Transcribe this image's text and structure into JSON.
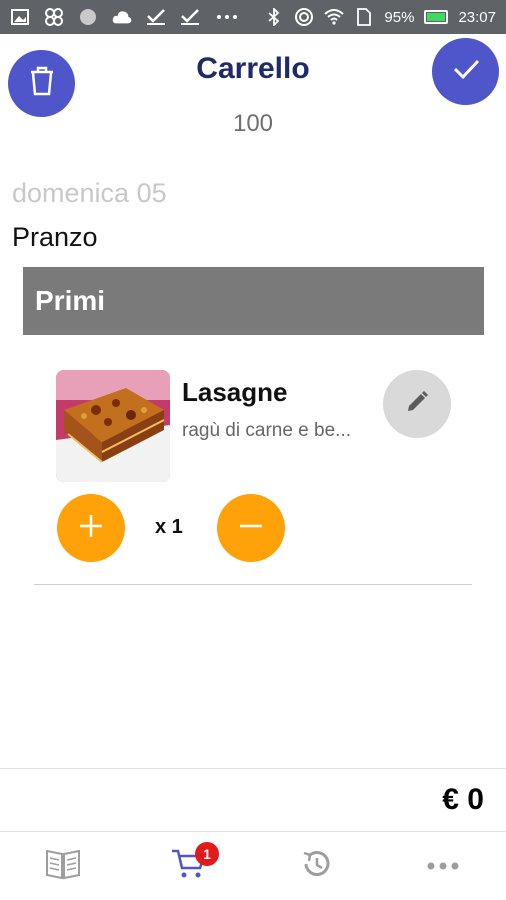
{
  "status_bar": {
    "battery": "95%",
    "time": "23:07",
    "icons": [
      "gallery-icon",
      "pinwheel-icon",
      "circle-icon",
      "cloud-icon",
      "check-icon",
      "check-icon",
      "more-dots-icon",
      "bluetooth-icon",
      "nfc-icon",
      "wifi-icon",
      "sim-icon",
      "battery-charging-icon"
    ]
  },
  "header": {
    "title": "Carrello",
    "points": "100",
    "left_icon": "trash-icon",
    "right_icon": "check-icon",
    "accent": "#4e56c9"
  },
  "order": {
    "date": "domenica 05",
    "meal": "Pranzo",
    "section": "Primi",
    "items": [
      {
        "name": "Lasagne",
        "description": "ragù di carne e be...",
        "quantity": "x 1"
      }
    ]
  },
  "total": "€ 0",
  "tabbar": {
    "items": [
      {
        "icon": "menu-book-icon"
      },
      {
        "icon": "cart-icon",
        "badge": "1",
        "active": true
      },
      {
        "icon": "history-icon"
      },
      {
        "icon": "more-icon"
      }
    ],
    "active_color": "#4e56c9",
    "inactive_color": "#9e9e9e"
  },
  "colors": {
    "quantity_button": "#ffa20a",
    "section_bg": "#7a7a7a",
    "badge": "#e31a1a"
  }
}
